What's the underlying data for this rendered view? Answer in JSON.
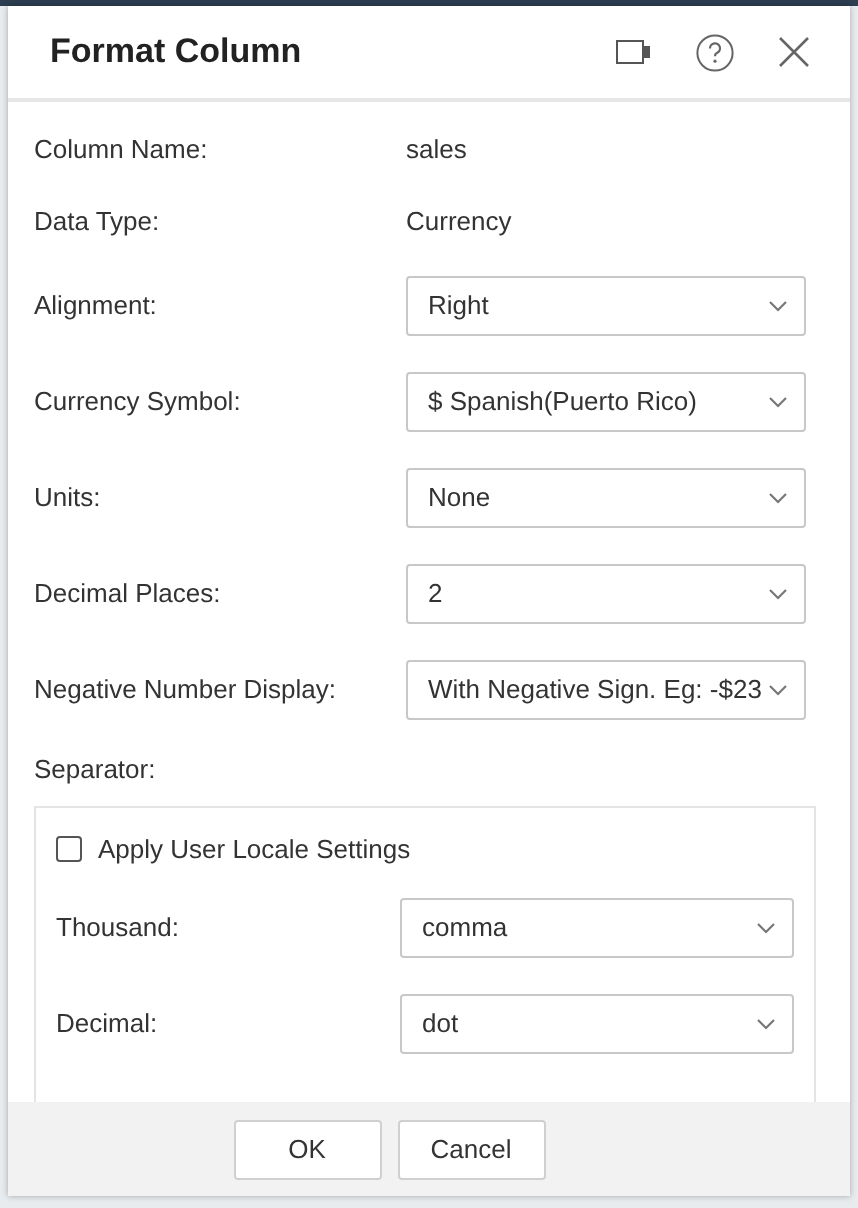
{
  "dialog": {
    "title": "Format Column"
  },
  "fields": [
    {
      "label": "Column Name:",
      "kind": "text",
      "value": "sales"
    },
    {
      "label": "Data Type:",
      "kind": "text",
      "value": "Currency"
    },
    {
      "label": "Alignment:",
      "kind": "select",
      "value": "Right"
    },
    {
      "label": "Currency Symbol:",
      "kind": "select",
      "value": "$ Spanish(Puerto Rico)"
    },
    {
      "label": "Units:",
      "kind": "select",
      "value": "None"
    },
    {
      "label": "Decimal Places:",
      "kind": "select",
      "value": "2"
    },
    {
      "label": "Negative Number Display:",
      "kind": "select",
      "value": "With Negative Sign. Eg: -$23"
    }
  ],
  "separator": {
    "label": "Separator:",
    "checkbox": {
      "label": "Apply User Locale Settings",
      "checked": false
    },
    "fields": [
      {
        "label": "Thousand:",
        "kind": "select",
        "value": "comma"
      },
      {
        "label": "Decimal:",
        "kind": "select",
        "value": "dot"
      }
    ]
  },
  "buttons": [
    {
      "label": "OK"
    },
    {
      "label": "Cancel"
    }
  ]
}
